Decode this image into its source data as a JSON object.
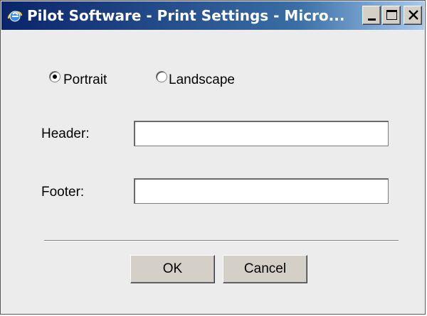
{
  "window": {
    "title": "Pilot Software - Print Settings - Micro...",
    "icon": "ie-icon",
    "caption_buttons": [
      "minimize-icon",
      "maximize-icon",
      "close-icon"
    ]
  },
  "orientation": {
    "options": [
      {
        "label": "Portrait",
        "selected": true
      },
      {
        "label": "Landscape",
        "selected": false
      }
    ]
  },
  "fields": {
    "header": {
      "label": "Header:",
      "value": "",
      "placeholder": ""
    },
    "footer": {
      "label": "Footer:",
      "value": "",
      "placeholder": ""
    }
  },
  "buttons": {
    "ok": "OK",
    "cancel": "Cancel"
  },
  "colors": {
    "title_bar_start": "#0a246a",
    "title_bar_end": "#a6caf0",
    "dialog_background": "#ececec",
    "button_face": "#d4d0c8"
  }
}
